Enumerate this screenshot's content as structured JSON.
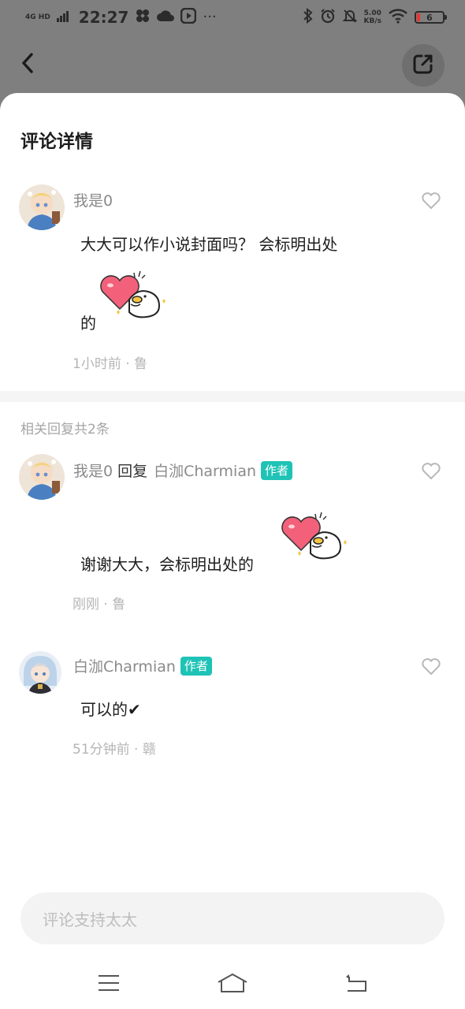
{
  "status_bar": {
    "network": "4G HD",
    "time": "22:27",
    "speed_value": "5.00",
    "speed_unit": "KB/s",
    "battery": "6"
  },
  "sheet": {
    "title": "评论详情"
  },
  "main_comment": {
    "user": "我是0",
    "text_line1": "大大可以作小说封面吗？ 会标明出处",
    "text_line2": "的",
    "meta": "1小时前 · 鲁",
    "sticker_icon": "heart-duck-sticker"
  },
  "replies_header": "相关回复共2条",
  "replies": [
    {
      "user": "我是0",
      "reply_word": "回复",
      "reply_to": "白泇Charmian",
      "tag": "作者",
      "text": "谢谢大大，会标明出处的",
      "meta": "刚刚 · 鲁",
      "sticker_icon": "heart-duck-sticker"
    },
    {
      "user": "白泇Charmian",
      "tag": "作者",
      "text": "可以的✔",
      "meta": "51分钟前 · 赣"
    }
  ],
  "input": {
    "placeholder": "评论支持太太"
  },
  "colors": {
    "author_tag": "#1fc3b6",
    "sticker_heart": "#f2607a"
  }
}
